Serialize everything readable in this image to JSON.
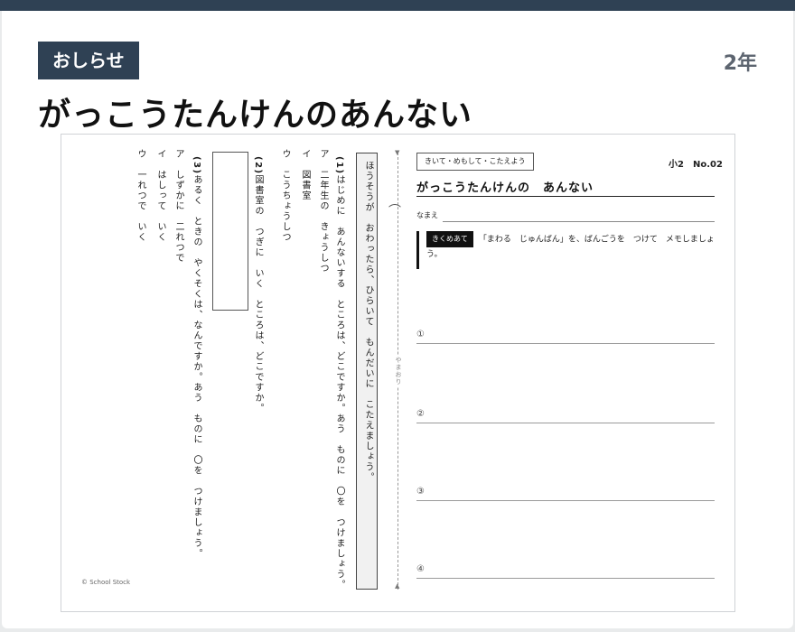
{
  "header": {
    "badge": "おしらせ",
    "grade": "2年",
    "title": "がっこうたんけんのあんない"
  },
  "sheet": {
    "instruction": "ほうそうが　おわったら、ひらいて　もんだいに　こたえましょう。",
    "questions": [
      {
        "num": "(1)",
        "text": "はじめに　あんないする　ところは、どこですか。あう　ものに　〇を　つけましょう。",
        "options": [
          "ア　二年生の　きょうしつ",
          "イ　図書室",
          "ウ　こうちょうしつ"
        ]
      },
      {
        "num": "(2)",
        "text": "図書室の　つぎに　いく　ところは、どこですか。"
      },
      {
        "num": "(3)",
        "text": "あるく　ときの　やくそくは、なんですか。あう　ものに　〇を　つけましょう。",
        "options": [
          "ア　しずかに　二れつで",
          "イ　はしって　いく",
          "ウ　一れつで　いく"
        ]
      }
    ],
    "fold_label": "やまおり",
    "copyright": "© School Stock",
    "skill_label": "きいて・めもして・こたえよう",
    "sheet_no": "小2　No.02",
    "sheet_title": "がっこうたんけんの　あんない",
    "name_label": "なまえ",
    "focus_tag": "きくめあて",
    "focus_text": "「まわる　じゅんばん」を、ばんごうを　つけて　メモしましょう。",
    "answer_marks": [
      "①",
      "②",
      "③",
      "④"
    ]
  }
}
